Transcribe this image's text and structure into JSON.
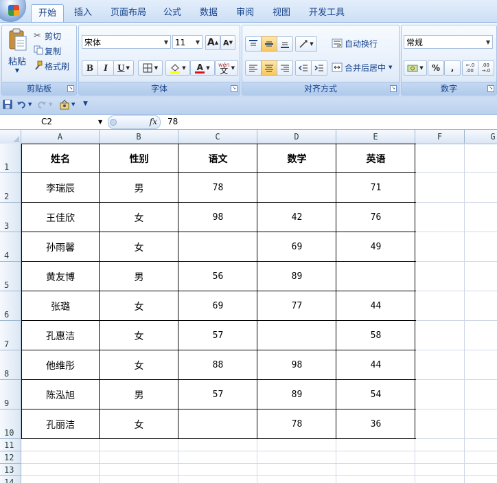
{
  "tabs": [
    "开始",
    "插入",
    "页面布局",
    "公式",
    "数据",
    "审阅",
    "视图",
    "开发工具"
  ],
  "active_tab": "开始",
  "clipboard": {
    "paste": "粘贴",
    "cut": "剪切",
    "copy": "复制",
    "format_painter": "格式刷",
    "label": "剪贴板"
  },
  "font": {
    "name": "宋体",
    "size": "11",
    "grow": "A",
    "shrink": "A",
    "bold": "B",
    "italic": "I",
    "underline": "U",
    "font_color_letter": "A",
    "phonetic_top": "wén",
    "phonetic_char": "文",
    "label": "字体"
  },
  "alignment": {
    "wrap": "自动换行",
    "merge": "合并后居中",
    "label": "对齐方式"
  },
  "number": {
    "format": "常规",
    "percent": "%",
    "comma": ",",
    "inc_decimal_top": "←.0",
    "inc_decimal_bottom": ".00",
    "dec_decimal_top": ".00",
    "dec_decimal_bottom": "→.0",
    "label": "数字"
  },
  "formula_bar": {
    "name_box": "C2",
    "fx": "fx",
    "value": "78"
  },
  "columns": [
    "A",
    "B",
    "C",
    "D",
    "E",
    "F",
    "G"
  ],
  "rows": [
    "1",
    "2",
    "3",
    "4",
    "5",
    "6",
    "7",
    "8",
    "9",
    "10",
    "11",
    "12",
    "13",
    "14"
  ],
  "table": {
    "headers": [
      "姓名",
      "性别",
      "语文",
      "数学",
      "英语"
    ],
    "records": [
      [
        "李瑞辰",
        "男",
        "78",
        "",
        "71"
      ],
      [
        "王佳欣",
        "女",
        "98",
        "42",
        "76"
      ],
      [
        "孙雨馨",
        "女",
        "",
        "69",
        "49"
      ],
      [
        "黄友博",
        "男",
        "56",
        "89",
        ""
      ],
      [
        "张璐",
        "女",
        "69",
        "77",
        "44"
      ],
      [
        "孔惠洁",
        "女",
        "57",
        "",
        "58"
      ],
      [
        "他维彤",
        "女",
        "88",
        "98",
        "44"
      ],
      [
        "陈泓旭",
        "男",
        "57",
        "89",
        "54"
      ],
      [
        "孔丽洁",
        "女",
        "",
        "78",
        "36"
      ]
    ]
  },
  "colors": {
    "ribbon": "#dbe8f8",
    "tab_text": "#15428b",
    "grid_line": "#d0d7e5",
    "table_border": "#000000"
  }
}
